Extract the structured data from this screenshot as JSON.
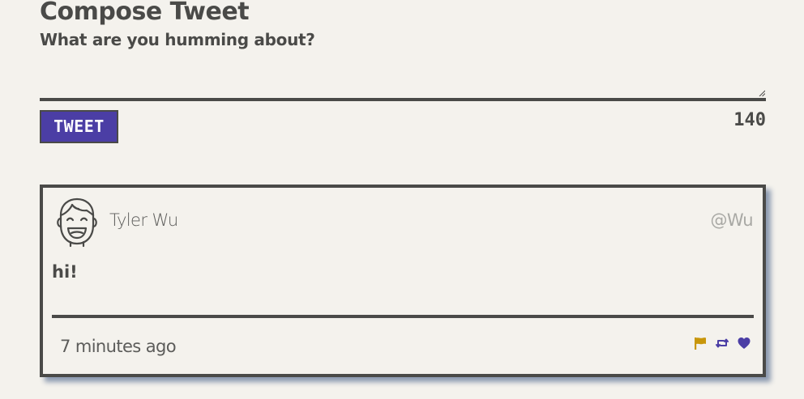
{
  "compose": {
    "title": "Compose Tweet",
    "subtitle": "What are you humming about?",
    "textarea_value": "",
    "tweet_button_label": "TWEET",
    "char_counter": "140"
  },
  "tweet": {
    "avatar_icon": "smiling-face-icon",
    "user_name": "Tyler Wu",
    "user_handle": "@Wu",
    "text": "hi!",
    "time": "7 minutes ago",
    "actions": [
      {
        "name": "flag-icon",
        "color": "#c8960a"
      },
      {
        "name": "retweet-icon",
        "color": "#4b3ea5"
      },
      {
        "name": "heart-icon",
        "color": "#4b3ea5"
      }
    ]
  },
  "colors": {
    "background": "#f4f2ed",
    "text": "#4a4a48",
    "accent": "#4b3ea5",
    "flag": "#c8960a",
    "handle": "#a8a8a4",
    "card_shadow": "#8c9ab0"
  }
}
